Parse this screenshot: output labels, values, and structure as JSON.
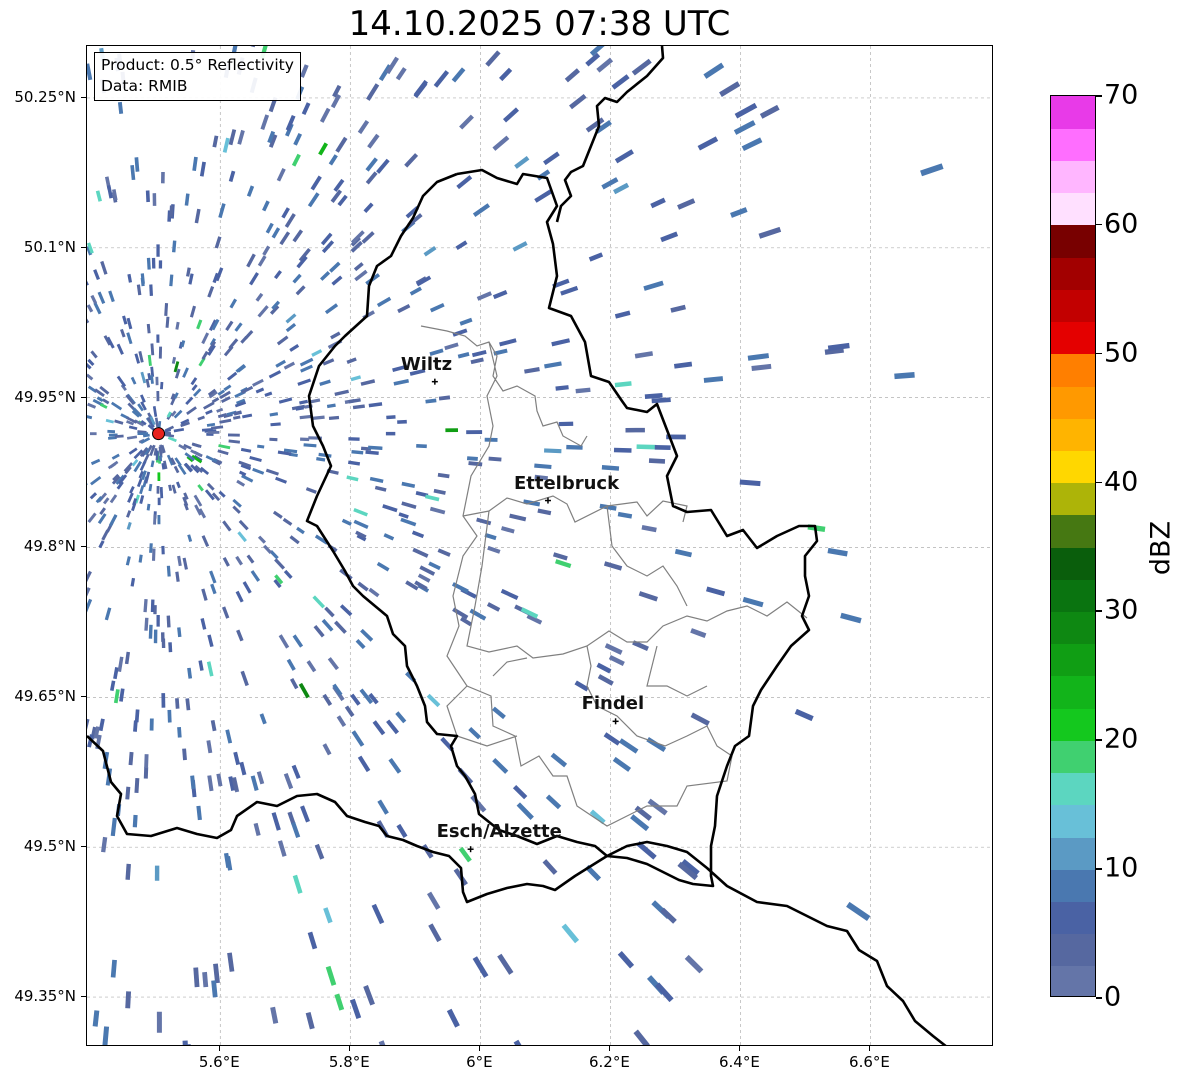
{
  "title": "14.10.2025 07:38 UTC",
  "info_box": {
    "product": "Product: 0.5° Reflectivity",
    "data_source": "Data: RMIB"
  },
  "y_axis": {
    "ticks": [
      {
        "lat": 50.25,
        "label": "50.25°N"
      },
      {
        "lat": 50.1,
        "label": "50.1°N"
      },
      {
        "lat": 49.95,
        "label": "49.95°N"
      },
      {
        "lat": 49.8,
        "label": "49.8°N"
      },
      {
        "lat": 49.65,
        "label": "49.65°N"
      },
      {
        "lat": 49.5,
        "label": "49.5°N"
      },
      {
        "lat": 49.35,
        "label": "49.35°N"
      }
    ]
  },
  "x_axis": {
    "ticks": [
      {
        "lon": 5.6,
        "label": "5.6°E"
      },
      {
        "lon": 5.8,
        "label": "5.8°E"
      },
      {
        "lon": 6.0,
        "label": "6°E"
      },
      {
        "lon": 6.2,
        "label": "6.2°E"
      },
      {
        "lon": 6.4,
        "label": "6.4°E"
      },
      {
        "lon": 6.6,
        "label": "6.6°E"
      }
    ]
  },
  "map_extent": {
    "lon_min": 5.395,
    "lon_max": 6.79,
    "lat_min": 49.3,
    "lat_max": 50.302
  },
  "cities": [
    {
      "name": "Wiltz",
      "lon": 5.93,
      "lat": 49.966
    },
    {
      "name": "Ettelbruck",
      "lon": 6.104,
      "lat": 49.847
    },
    {
      "name": "Findel",
      "lon": 6.208,
      "lat": 49.626
    },
    {
      "name": "Esch/Alzette",
      "lon": 5.985,
      "lat": 49.498
    }
  ],
  "radar_site": {
    "lon": 5.505,
    "lat": 49.914,
    "marker_color": "#e8221c"
  },
  "colorbar": {
    "label": "dBZ",
    "min": 0,
    "max": 70,
    "tick_labels": [
      "0",
      "10",
      "20",
      "30",
      "40",
      "50",
      "60",
      "70"
    ],
    "colors": [
      "#6475a8",
      "#5668a0",
      "#4a62a4",
      "#4a78b0",
      "#5b9ac4",
      "#68c0d8",
      "#5cd6c0",
      "#40d070",
      "#14c81e",
      "#12b41a",
      "#109e14",
      "#0e8812",
      "#0a7410",
      "#0a5e0c",
      "#467812",
      "#adb408",
      "#ffd700",
      "#ffb400",
      "#ff9900",
      "#ff7f00",
      "#e40000",
      "#c20000",
      "#a20000",
      "#780000",
      "#ffe0ff",
      "#ffb6ff",
      "#ff6eff",
      "#e83ae8"
    ]
  }
}
